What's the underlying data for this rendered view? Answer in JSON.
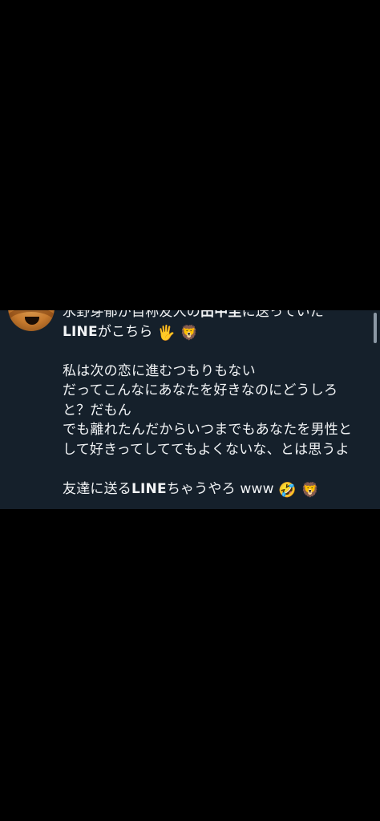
{
  "post": {
    "line1_part1": "氷野芽郁が自称友人の",
    "line1_bold": "田中圭",
    "line1_part2": "に送っていた",
    "line2_bold": "LINE",
    "line2_text": "がこちら",
    "line2_emoji1": "🖐",
    "line2_emoji2": "🦁",
    "line3": "私は次の恋に進むつもりもない",
    "line4": "だってこんなにあなたを好きなのにどうしろ",
    "line5": "と？だもん",
    "line6": "でも離れたんだからいつまでもあなたを男性と",
    "line7": "して好きってしててもよくないな、とは思うよ",
    "line8_part1": "友達に送る",
    "line8_bold": "LINE",
    "line8_part2": "ちゃうやろ www",
    "line8_emoji1": "🤣",
    "line8_emoji2": "🦁"
  }
}
